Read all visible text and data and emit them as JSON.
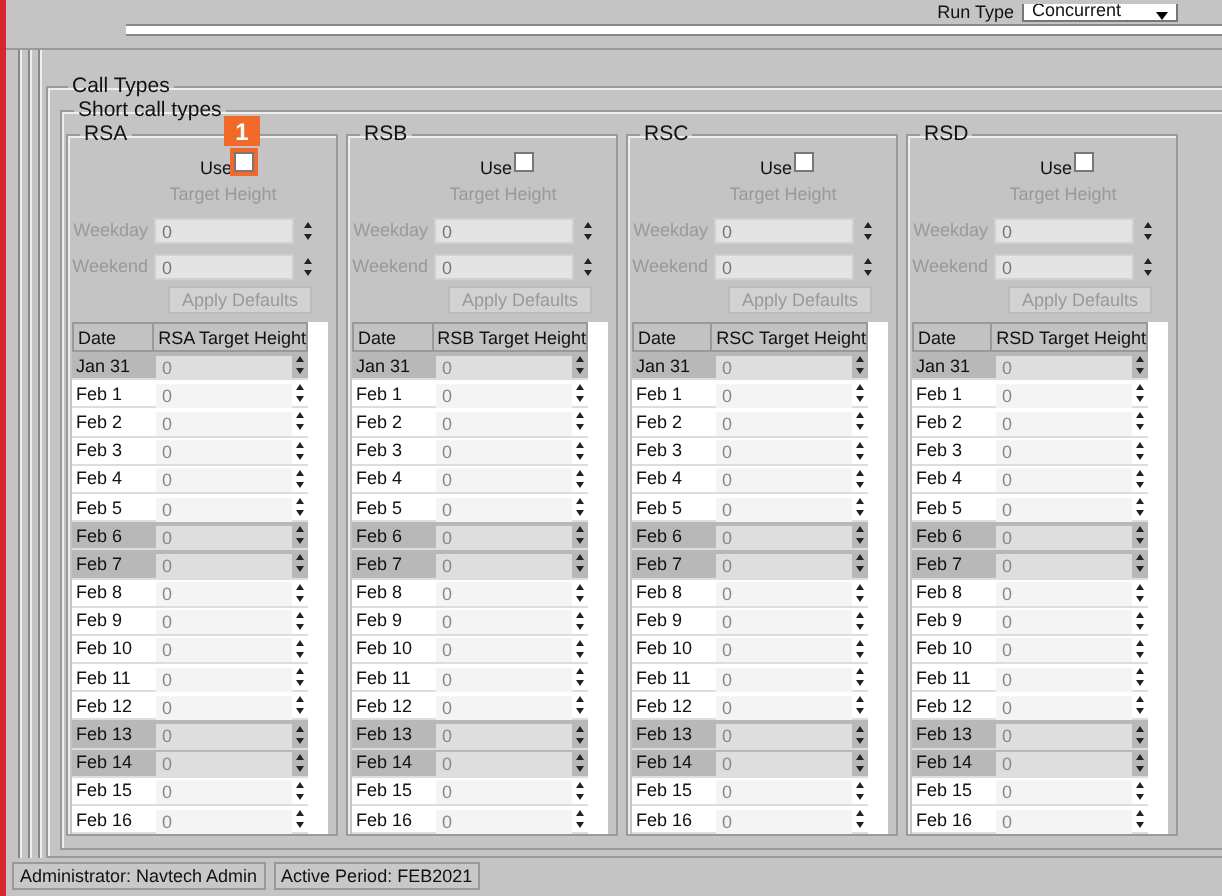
{
  "toolbar": {
    "run_type_label": "Run Type",
    "run_type_value": "Concurrent"
  },
  "call_types": {
    "title": "Call Types",
    "short_title": "Short call types",
    "panels": [
      {
        "name": "RSA",
        "use_label": "Use",
        "use_checked": false,
        "marker": "1",
        "target_label": "Target Height",
        "weekday_label": "Weekday",
        "weekday_value": "0",
        "weekend_label": "Weekend",
        "weekend_value": "0",
        "apply_button": "Apply Defaults",
        "defaults_disabled": true,
        "columns": [
          "Date",
          "RSA Target Height"
        ],
        "rows": [
          {
            "date": "Jan 31",
            "value": "0",
            "weekend": true
          },
          {
            "date": "Feb 1",
            "value": "0",
            "weekend": false
          },
          {
            "date": "Feb 2",
            "value": "0",
            "weekend": false
          },
          {
            "date": "Feb 3",
            "value": "0",
            "weekend": false
          },
          {
            "date": "Feb 4",
            "value": "0",
            "weekend": false
          },
          {
            "date": "Feb 5",
            "value": "0",
            "weekend": false
          },
          {
            "date": "Feb 6",
            "value": "0",
            "weekend": true
          },
          {
            "date": "Feb 7",
            "value": "0",
            "weekend": true
          },
          {
            "date": "Feb 8",
            "value": "0",
            "weekend": false
          },
          {
            "date": "Feb 9",
            "value": "0",
            "weekend": false
          },
          {
            "date": "Feb 10",
            "value": "0",
            "weekend": false
          },
          {
            "date": "Feb 11",
            "value": "0",
            "weekend": false
          },
          {
            "date": "Feb 12",
            "value": "0",
            "weekend": false
          },
          {
            "date": "Feb 13",
            "value": "0",
            "weekend": true
          },
          {
            "date": "Feb 14",
            "value": "0",
            "weekend": true
          },
          {
            "date": "Feb 15",
            "value": "0",
            "weekend": false
          },
          {
            "date": "Feb 16",
            "value": "0",
            "weekend": false
          }
        ]
      },
      {
        "name": "RSB",
        "use_label": "Use",
        "use_checked": false,
        "target_label": "Target Height",
        "weekday_label": "Weekday",
        "weekday_value": "0",
        "weekend_label": "Weekend",
        "weekend_value": "0",
        "apply_button": "Apply Defaults",
        "defaults_disabled": true,
        "columns": [
          "Date",
          "RSB Target Height"
        ],
        "rows": [
          {
            "date": "Jan 31",
            "value": "0",
            "weekend": true
          },
          {
            "date": "Feb 1",
            "value": "0",
            "weekend": false
          },
          {
            "date": "Feb 2",
            "value": "0",
            "weekend": false
          },
          {
            "date": "Feb 3",
            "value": "0",
            "weekend": false
          },
          {
            "date": "Feb 4",
            "value": "0",
            "weekend": false
          },
          {
            "date": "Feb 5",
            "value": "0",
            "weekend": false
          },
          {
            "date": "Feb 6",
            "value": "0",
            "weekend": true
          },
          {
            "date": "Feb 7",
            "value": "0",
            "weekend": true
          },
          {
            "date": "Feb 8",
            "value": "0",
            "weekend": false
          },
          {
            "date": "Feb 9",
            "value": "0",
            "weekend": false
          },
          {
            "date": "Feb 10",
            "value": "0",
            "weekend": false
          },
          {
            "date": "Feb 11",
            "value": "0",
            "weekend": false
          },
          {
            "date": "Feb 12",
            "value": "0",
            "weekend": false
          },
          {
            "date": "Feb 13",
            "value": "0",
            "weekend": true
          },
          {
            "date": "Feb 14",
            "value": "0",
            "weekend": true
          },
          {
            "date": "Feb 15",
            "value": "0",
            "weekend": false
          },
          {
            "date": "Feb 16",
            "value": "0",
            "weekend": false
          }
        ]
      },
      {
        "name": "RSC",
        "use_label": "Use",
        "use_checked": false,
        "target_label": "Target Height",
        "weekday_label": "Weekday",
        "weekday_value": "0",
        "weekend_label": "Weekend",
        "weekend_value": "0",
        "apply_button": "Apply Defaults",
        "defaults_disabled": true,
        "columns": [
          "Date",
          "RSC Target Height"
        ],
        "rows": [
          {
            "date": "Jan 31",
            "value": "0",
            "weekend": true
          },
          {
            "date": "Feb 1",
            "value": "0",
            "weekend": false
          },
          {
            "date": "Feb 2",
            "value": "0",
            "weekend": false
          },
          {
            "date": "Feb 3",
            "value": "0",
            "weekend": false
          },
          {
            "date": "Feb 4",
            "value": "0",
            "weekend": false
          },
          {
            "date": "Feb 5",
            "value": "0",
            "weekend": false
          },
          {
            "date": "Feb 6",
            "value": "0",
            "weekend": true
          },
          {
            "date": "Feb 7",
            "value": "0",
            "weekend": true
          },
          {
            "date": "Feb 8",
            "value": "0",
            "weekend": false
          },
          {
            "date": "Feb 9",
            "value": "0",
            "weekend": false
          },
          {
            "date": "Feb 10",
            "value": "0",
            "weekend": false
          },
          {
            "date": "Feb 11",
            "value": "0",
            "weekend": false
          },
          {
            "date": "Feb 12",
            "value": "0",
            "weekend": false
          },
          {
            "date": "Feb 13",
            "value": "0",
            "weekend": true
          },
          {
            "date": "Feb 14",
            "value": "0",
            "weekend": true
          },
          {
            "date": "Feb 15",
            "value": "0",
            "weekend": false
          },
          {
            "date": "Feb 16",
            "value": "0",
            "weekend": false
          }
        ]
      },
      {
        "name": "RSD",
        "use_label": "Use",
        "use_checked": false,
        "target_label": "Target Height",
        "weekday_label": "Weekday",
        "weekday_value": "0",
        "weekend_label": "Weekend",
        "weekend_value": "0",
        "apply_button": "Apply Defaults",
        "defaults_disabled": true,
        "columns": [
          "Date",
          "RSD Target Height"
        ],
        "rows": [
          {
            "date": "Jan 31",
            "value": "0",
            "weekend": true
          },
          {
            "date": "Feb 1",
            "value": "0",
            "weekend": false
          },
          {
            "date": "Feb 2",
            "value": "0",
            "weekend": false
          },
          {
            "date": "Feb 3",
            "value": "0",
            "weekend": false
          },
          {
            "date": "Feb 4",
            "value": "0",
            "weekend": false
          },
          {
            "date": "Feb 5",
            "value": "0",
            "weekend": false
          },
          {
            "date": "Feb 6",
            "value": "0",
            "weekend": true
          },
          {
            "date": "Feb 7",
            "value": "0",
            "weekend": true
          },
          {
            "date": "Feb 8",
            "value": "0",
            "weekend": false
          },
          {
            "date": "Feb 9",
            "value": "0",
            "weekend": false
          },
          {
            "date": "Feb 10",
            "value": "0",
            "weekend": false
          },
          {
            "date": "Feb 11",
            "value": "0",
            "weekend": false
          },
          {
            "date": "Feb 12",
            "value": "0",
            "weekend": false
          },
          {
            "date": "Feb 13",
            "value": "0",
            "weekend": true
          },
          {
            "date": "Feb 14",
            "value": "0",
            "weekend": true
          },
          {
            "date": "Feb 15",
            "value": "0",
            "weekend": false
          },
          {
            "date": "Feb 16",
            "value": "0",
            "weekend": false
          }
        ]
      }
    ]
  },
  "status_bar": [
    "Administrator: Navtech Admin",
    "Active Period: FEB2021"
  ]
}
